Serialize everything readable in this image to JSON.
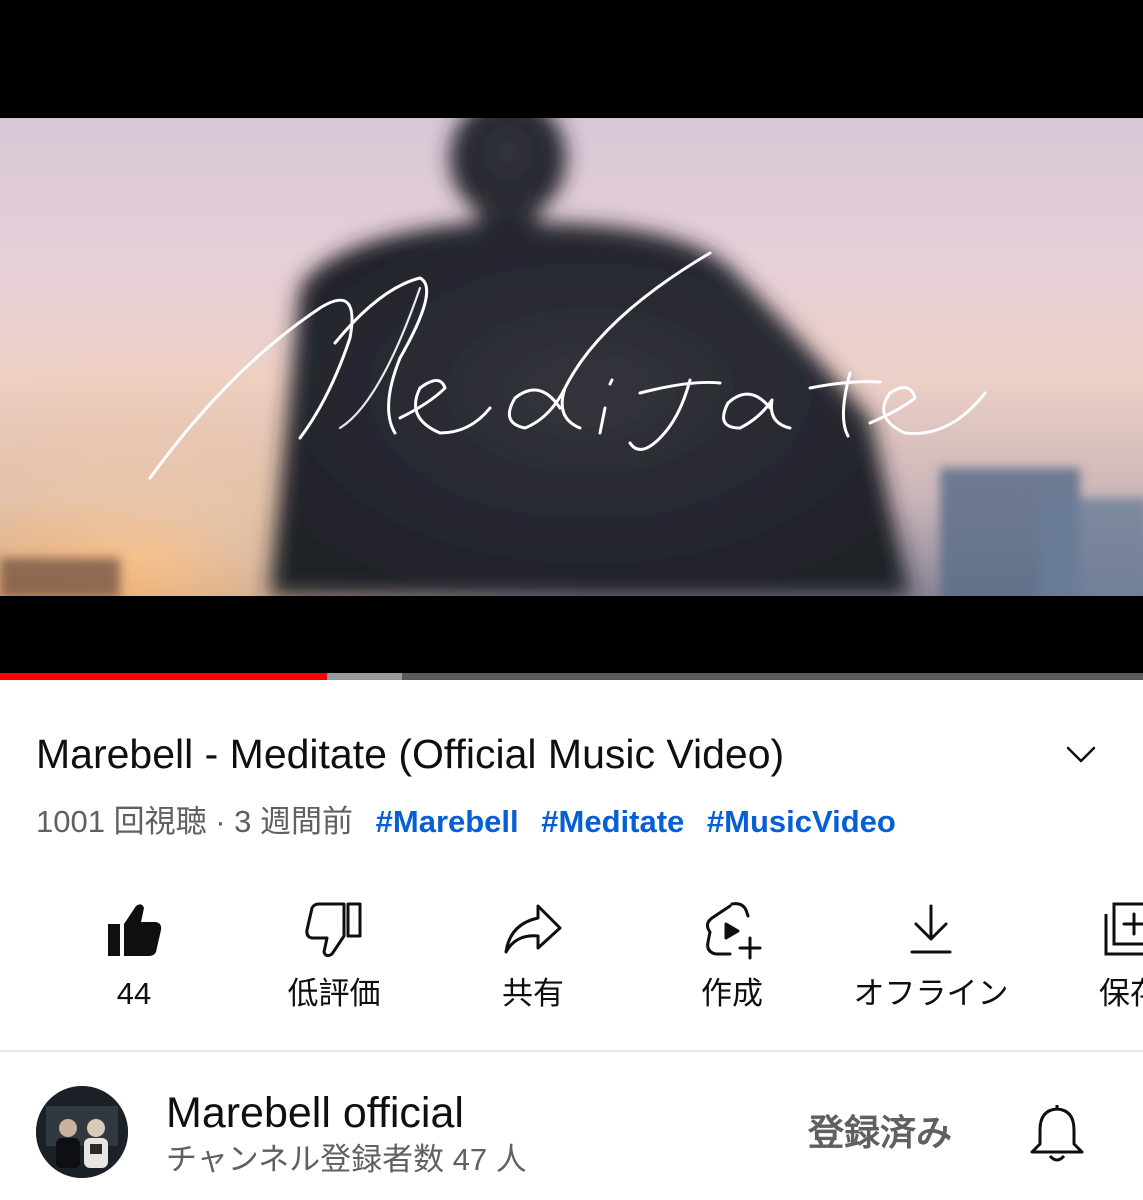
{
  "video": {
    "overlay_title": "Meditate",
    "progress_played_fraction": 0.286,
    "progress_buffered_fraction": 0.352,
    "colors": {
      "played": "#ff0000",
      "buffered": "#9a9a9a",
      "track": "#5a5a5a"
    }
  },
  "title": "Marebell - Meditate (Official Music Video)",
  "meta": {
    "views": "1001 回視聴",
    "separator": "·",
    "age": "3 週間前",
    "hashtags": [
      "#Marebell",
      "#Meditate",
      "#MusicVideo"
    ],
    "hashtag_color": "#065fd4"
  },
  "actions": [
    {
      "id": "like",
      "label": "44",
      "icon": "thumbs-up-filled-icon"
    },
    {
      "id": "dislike",
      "label": "低評価",
      "icon": "thumbs-down-icon"
    },
    {
      "id": "share",
      "label": "共有",
      "icon": "share-arrow-icon"
    },
    {
      "id": "create",
      "label": "作成",
      "icon": "create-remix-icon"
    },
    {
      "id": "offline",
      "label": "オフライン",
      "icon": "download-icon"
    },
    {
      "id": "save",
      "label": "保存",
      "icon": "save-playlist-icon"
    }
  ],
  "channel": {
    "name": "Marebell official",
    "subscribers": "チャンネル登録者数 47 人",
    "subscribe_state": "登録済み",
    "bell_icon": "bell-icon"
  }
}
